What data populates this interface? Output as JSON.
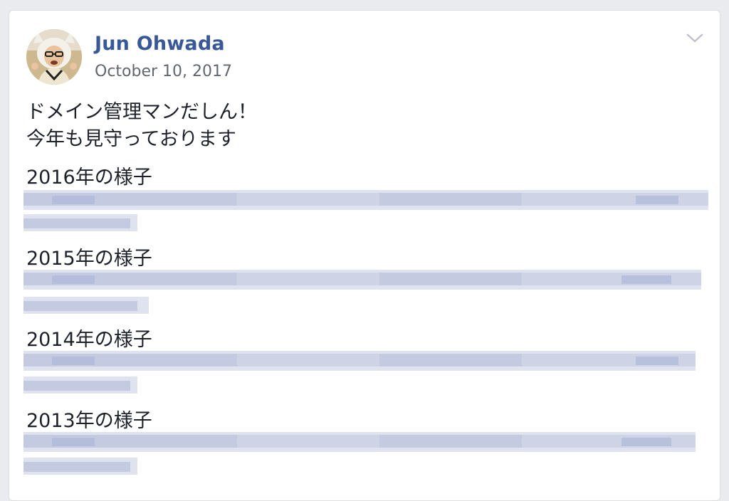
{
  "post": {
    "author": "Jun Ohwada",
    "date": "October 10, 2017",
    "message_lines": [
      "ドメイン管理マンだしん！",
      "今年も見守っております"
    ],
    "year_sections": [
      {
        "heading": "2016年の様子"
      },
      {
        "heading": "2015年の様子"
      },
      {
        "heading": "2014年の様子"
      },
      {
        "heading": "2013年の様子"
      }
    ]
  },
  "colors": {
    "author_link": "#385898",
    "timestamp": "#616770",
    "text": "#1d2129",
    "blur_light": "#dfe3ef",
    "blur_mid": "#c4cbe0",
    "blur_dark": "#aab4d3"
  },
  "icons": {
    "menu": "chevron-down-icon"
  }
}
